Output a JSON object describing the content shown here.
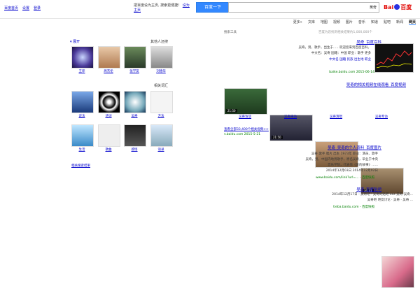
{
  "top_links": [
    "百度首页",
    "设置",
    "登录"
  ],
  "tip": {
    "text": "把百度设为主页,  搜索更便捷！",
    "link": "设为主页"
  },
  "search": {
    "button": "百度一下",
    "query": "吴奇"
  },
  "logo": {
    "left": "Bai",
    "right": "百度"
  },
  "tabs": [
    "网页",
    "新闻",
    "贴吧",
    "知道",
    "音乐",
    "图片",
    "视频",
    "地图",
    "文库",
    "更多»"
  ],
  "result_count": "百度为您找到相关结果约1,000,000个",
  "tools": "搜索工具",
  "results": {
    "r1": {
      "title": "吴奇_百度百科",
      "snippet1": "吴奇，男，歌手，出生于……欢迎您来到百度百科。",
      "snippet2": "中文名：吴奇 国籍：中国 职业：歌手 更多",
      "meta": "中文名 国籍 民族 出生地 职业",
      "url": "baike.baidu.com 2015-06-14"
    },
    "r2": {
      "title": "吴奇的相关视频在线观看_百度视频",
      "videos": [
        {
          "dur": "34:31",
          "cap": "吴奇专访"
        },
        {
          "dur": "",
          "cap": "吴奇演唱"
        },
        {
          "dur": "21:50",
          "cap": "吴奇采访"
        },
        {
          "dur": "21:50",
          "cap": "吴奇访谈"
        }
      ],
      "more": "查看全部33,400个相关视频>>",
      "url": "v.baidu.com 2015-5-21"
    },
    "r3": {
      "title": "吴奇_吴奇的个人资料_百度图片",
      "meta": "吴奇 歌手 唱片 出生 1973年 职业：演员、歌手",
      "snippet1": "吴奇，男，中国内地男歌手，原名吴奇，毕业于中央",
      "snippet2": "音乐学院，代表作《爱的故事》……",
      "snippet3": "2014年12月03日  2014年12月02日",
      "url": "www.baidu.com/link?url=... - 百度快照"
    },
    "r4": {
      "title": "吴奇_百度贴吧",
      "snippet1": "2014年12月17日 - 吴奇吧 · 吴奇的贴吧 xxx 吴奇 吴奇...",
      "snippet2": "吴奇吧 吧友讨论 · 吴奇 · 吴奇 ...",
      "url": "tieba.baidu.com - 百度快照"
    }
  },
  "sidebar": {
    "related_people_title": "其他人还搜",
    "expand": "展开",
    "people": [
      "刘德华",
      "张学友",
      "周杰伦",
      "王菲"
    ],
    "related_words_title": "相关词汇",
    "words_row1": [
      "方法",
      "吴奇",
      "诗词",
      "说法"
    ],
    "words_row2": [
      "语录",
      "感悟",
      "歌曲",
      "生活"
    ],
    "footer": "相关搜索结果"
  }
}
